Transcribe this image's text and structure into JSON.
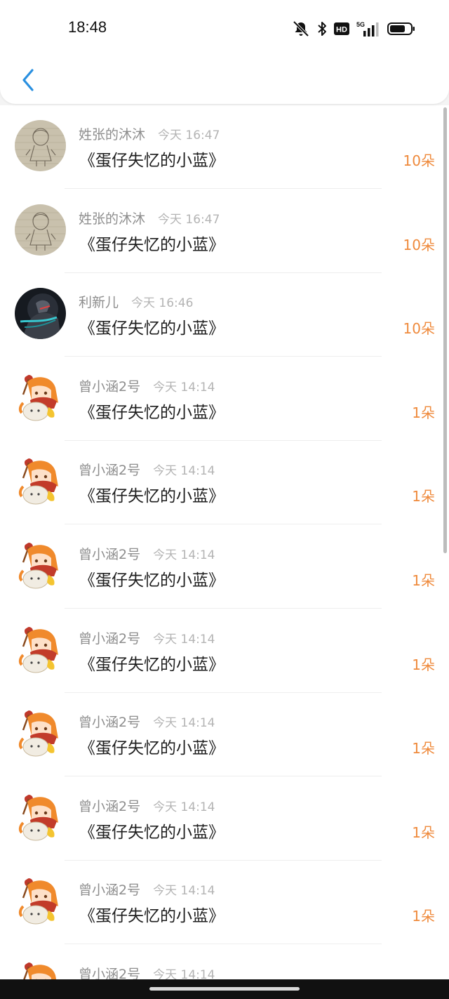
{
  "status_bar": {
    "time": "18:48",
    "icons": [
      "bell-off-icon",
      "bluetooth-icon",
      "hd-icon",
      "signal-5g-icon",
      "battery-icon"
    ],
    "hd_label": "HD",
    "network_label": "5G"
  },
  "header": {
    "back_icon": "chevron-left-icon",
    "accent": "#2a90e0"
  },
  "colors": {
    "amount": "#ef8a3c",
    "name": "#8e8e8e",
    "time": "#b4b4b4"
  },
  "items": [
    {
      "name": "姓张的沐沐",
      "time": "今天 16:47",
      "title": "《蛋仔失忆的小蓝》",
      "amount": "10朵",
      "avatar": "sketch"
    },
    {
      "name": "姓张的沐沐",
      "time": "今天 16:47",
      "title": "《蛋仔失忆的小蓝》",
      "amount": "10朵",
      "avatar": "sketch"
    },
    {
      "name": "利新儿",
      "time": "今天 16:46",
      "title": "《蛋仔失忆的小蓝》",
      "amount": "10朵",
      "avatar": "dark"
    },
    {
      "name": "曾小涵2号",
      "time": "今天 14:14",
      "title": "《蛋仔失忆的小蓝》",
      "amount": "1朵",
      "avatar": "anime"
    },
    {
      "name": "曾小涵2号",
      "time": "今天 14:14",
      "title": "《蛋仔失忆的小蓝》",
      "amount": "1朵",
      "avatar": "anime"
    },
    {
      "name": "曾小涵2号",
      "time": "今天 14:14",
      "title": "《蛋仔失忆的小蓝》",
      "amount": "1朵",
      "avatar": "anime"
    },
    {
      "name": "曾小涵2号",
      "time": "今天 14:14",
      "title": "《蛋仔失忆的小蓝》",
      "amount": "1朵",
      "avatar": "anime"
    },
    {
      "name": "曾小涵2号",
      "time": "今天 14:14",
      "title": "《蛋仔失忆的小蓝》",
      "amount": "1朵",
      "avatar": "anime"
    },
    {
      "name": "曾小涵2号",
      "time": "今天 14:14",
      "title": "《蛋仔失忆的小蓝》",
      "amount": "1朵",
      "avatar": "anime"
    },
    {
      "name": "曾小涵2号",
      "time": "今天 14:14",
      "title": "《蛋仔失忆的小蓝》",
      "amount": "1朵",
      "avatar": "anime"
    },
    {
      "name": "曾小涵2号",
      "time": "今天 14:14",
      "title": "",
      "amount": "",
      "avatar": "anime"
    }
  ]
}
